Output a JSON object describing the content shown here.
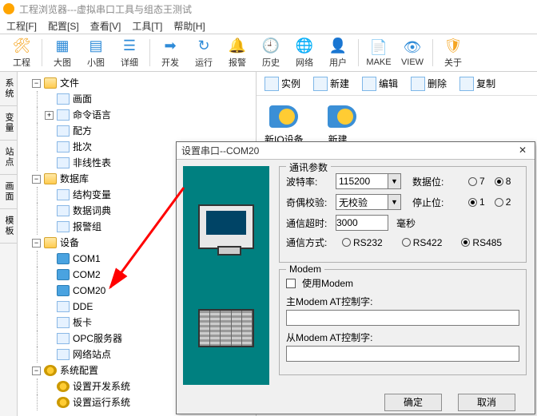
{
  "window": {
    "title": "工程浏览器---虚拟串口工具与组态王测试"
  },
  "menu": {
    "m0": "工程[F]",
    "m1": "配置[S]",
    "m2": "查看[V]",
    "m3": "工具[T]",
    "m4": "帮助[H]"
  },
  "tb": {
    "project": "工程",
    "big": "大图",
    "small": "小图",
    "detail": "详细",
    "dev": "开发",
    "run": "运行",
    "alarm": "报警",
    "history": "历史",
    "net": "网络",
    "user": "用户",
    "make": "MAKE",
    "view": "VIEW",
    "about": "关于"
  },
  "sidetabs": {
    "t0": "系统",
    "t1": "变量",
    "t2": "站点",
    "t3": "画面",
    "t4": "模板"
  },
  "tree": {
    "file": "文件",
    "screen": "画面",
    "cmdlang": "命令语言",
    "recipe": "配方",
    "batch": "批次",
    "nonlinear": "非线性表",
    "db": "数据库",
    "structvar": "结构变量",
    "dict": "数据词典",
    "alarmgrp": "报警组",
    "device": "设备",
    "com1": "COM1",
    "com2": "COM2",
    "com20": "COM20",
    "dde": "DDE",
    "card": "板卡",
    "opc": "OPC服务器",
    "netsite": "网络站点",
    "syscfg": "系统配置",
    "cfgdev": "设置开发系统",
    "cfgrun": "设置运行系统"
  },
  "rtool": {
    "inst": "实例",
    "new": "新建",
    "edit": "编辑",
    "del": "删除",
    "copy": "复制"
  },
  "icons": {
    "newio": "新IO设备",
    "newgeneric": "新建..."
  },
  "dialog": {
    "title": "设置串口--COM20",
    "grp_comm": "通讯参数",
    "baud_lbl": "波特率:",
    "baud_val": "115200",
    "databits_lbl": "数据位:",
    "d7": "7",
    "d8": "8",
    "parity_lbl": "奇偶校验:",
    "parity_val": "无校验",
    "stopbits_lbl": "停止位:",
    "s1": "1",
    "s2": "2",
    "timeout_lbl": "通信超时:",
    "timeout_val": "3000",
    "timeout_unit": "毫秒",
    "mode_lbl": "通信方式:",
    "m232": "RS232",
    "m422": "RS422",
    "m485": "RS485",
    "grp_modem": "Modem",
    "use_modem": "使用Modem",
    "main_at": "主Modem AT控制字:",
    "sub_at": "从Modem AT控制字:",
    "ok": "确定",
    "cancel": "取消"
  }
}
